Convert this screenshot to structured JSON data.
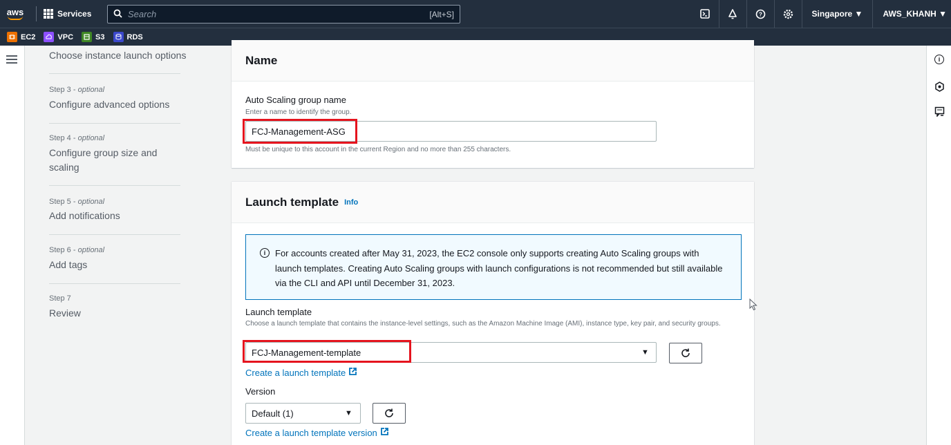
{
  "topnav": {
    "logo_text": "aws",
    "services_label": "Services",
    "search_placeholder": "Search",
    "search_shortcut": "[Alt+S]",
    "region": "Singapore ▼",
    "account": "AWS_KHANH ▼",
    "icons": [
      "cloudshell-icon",
      "bell-icon",
      "help-icon",
      "settings-icon"
    ]
  },
  "favorites": [
    {
      "label": "EC2",
      "color": "#ed7100",
      "icon": "ec2-icon"
    },
    {
      "label": "VPC",
      "color": "#8c4fff",
      "icon": "vpc-icon"
    },
    {
      "label": "S3",
      "color": "#3f8624",
      "icon": "s3-icon"
    },
    {
      "label": "RDS",
      "color": "#3b48cc",
      "icon": "rds-icon"
    }
  ],
  "steps": {
    "step2_title": "Choose instance launch options",
    "step3_label": "Step 3 - ",
    "step3_optional": "optional",
    "step3_title": "Configure advanced options",
    "step4_label": "Step 4 - ",
    "step4_optional": "optional",
    "step4_title": "Configure group size and scaling",
    "step5_label": "Step 5 - ",
    "step5_optional": "optional",
    "step5_title": "Add notifications",
    "step6_label": "Step 6 - ",
    "step6_optional": "optional",
    "step6_title": "Add tags",
    "step7_label": "Step 7",
    "step7_title": "Review"
  },
  "name_panel": {
    "title": "Name",
    "field_label": "Auto Scaling group name",
    "field_desc": "Enter a name to identify the group.",
    "field_value": "FCJ-Management-ASG",
    "field_hint": "Must be unique to this account in the current Region and no more than 255 characters."
  },
  "launch_panel": {
    "title": "Launch template",
    "info": "Info",
    "alert_text": "For accounts created after May 31, 2023, the EC2 console only supports creating Auto Scaling groups with launch templates. Creating Auto Scaling groups with launch configurations is not recommended but still available via the CLI and API until December 31, 2023.",
    "lt_label": "Launch template",
    "lt_desc": "Choose a launch template that contains the instance-level settings, such as the Amazon Machine Image (AMI), instance type, key pair, and security groups.",
    "lt_value": "FCJ-Management-template",
    "create_lt_link": "Create a launch template",
    "version_label": "Version",
    "version_value": "Default (1)",
    "create_version_link": "Create a launch template version"
  },
  "colors": {
    "nav_bg": "#232f3e",
    "accent": "#ff9900",
    "link": "#0073bb",
    "highlight": "#e5141e"
  }
}
